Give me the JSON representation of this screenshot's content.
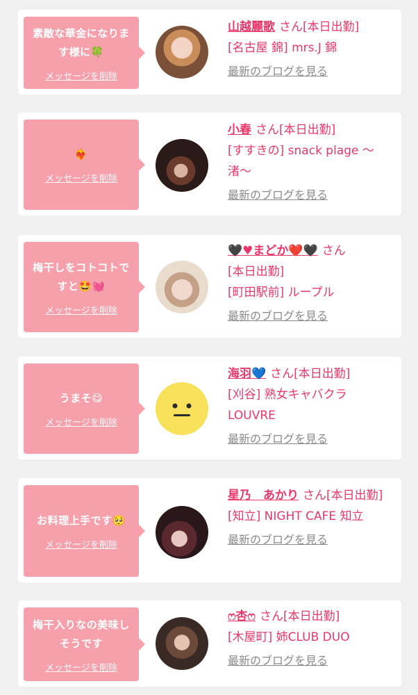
{
  "common": {
    "delete_label": "メッセージを削除",
    "blog_label": "最新のブログを見る",
    "honorific": "さん"
  },
  "cards": [
    {
      "message": "素敵な華金になります様に🍀",
      "name": "山越麗歌",
      "status": "[本日出勤]",
      "shop": "[名古屋 錦] mrs.J 錦"
    },
    {
      "message": "❤️‍🔥",
      "name": "小春",
      "status": "[本日出勤]",
      "shop": "[すすきの] snack plage 〜渚〜"
    },
    {
      "message": "梅干しをコトコトですと🤩💓",
      "name": "🖤♥まどか❤️🖤",
      "status": "[本日出勤]",
      "shop": "[町田駅前] ループル"
    },
    {
      "message": "うまそ😋",
      "name": "海羽💙",
      "status": "[本日出勤]",
      "shop": "[刈谷] 熟女キャバクラ LOUVRE"
    },
    {
      "message": "お料理上手です🥺",
      "name": "星乃　あかり",
      "status": "[本日出勤]",
      "shop": "[知立] NIGHT CAFE 知立"
    },
    {
      "message": "梅干入りなの美味しそうです",
      "name": "ෆ杏ෆ",
      "status": "[本日出勤]",
      "shop": "[木屋町] 姉CLUB DUO"
    }
  ],
  "colors": {
    "bubble": "#f6a0ab",
    "accent": "#e8386b",
    "link_gray": "#8a8a8a",
    "background": "#f0f0f0"
  }
}
